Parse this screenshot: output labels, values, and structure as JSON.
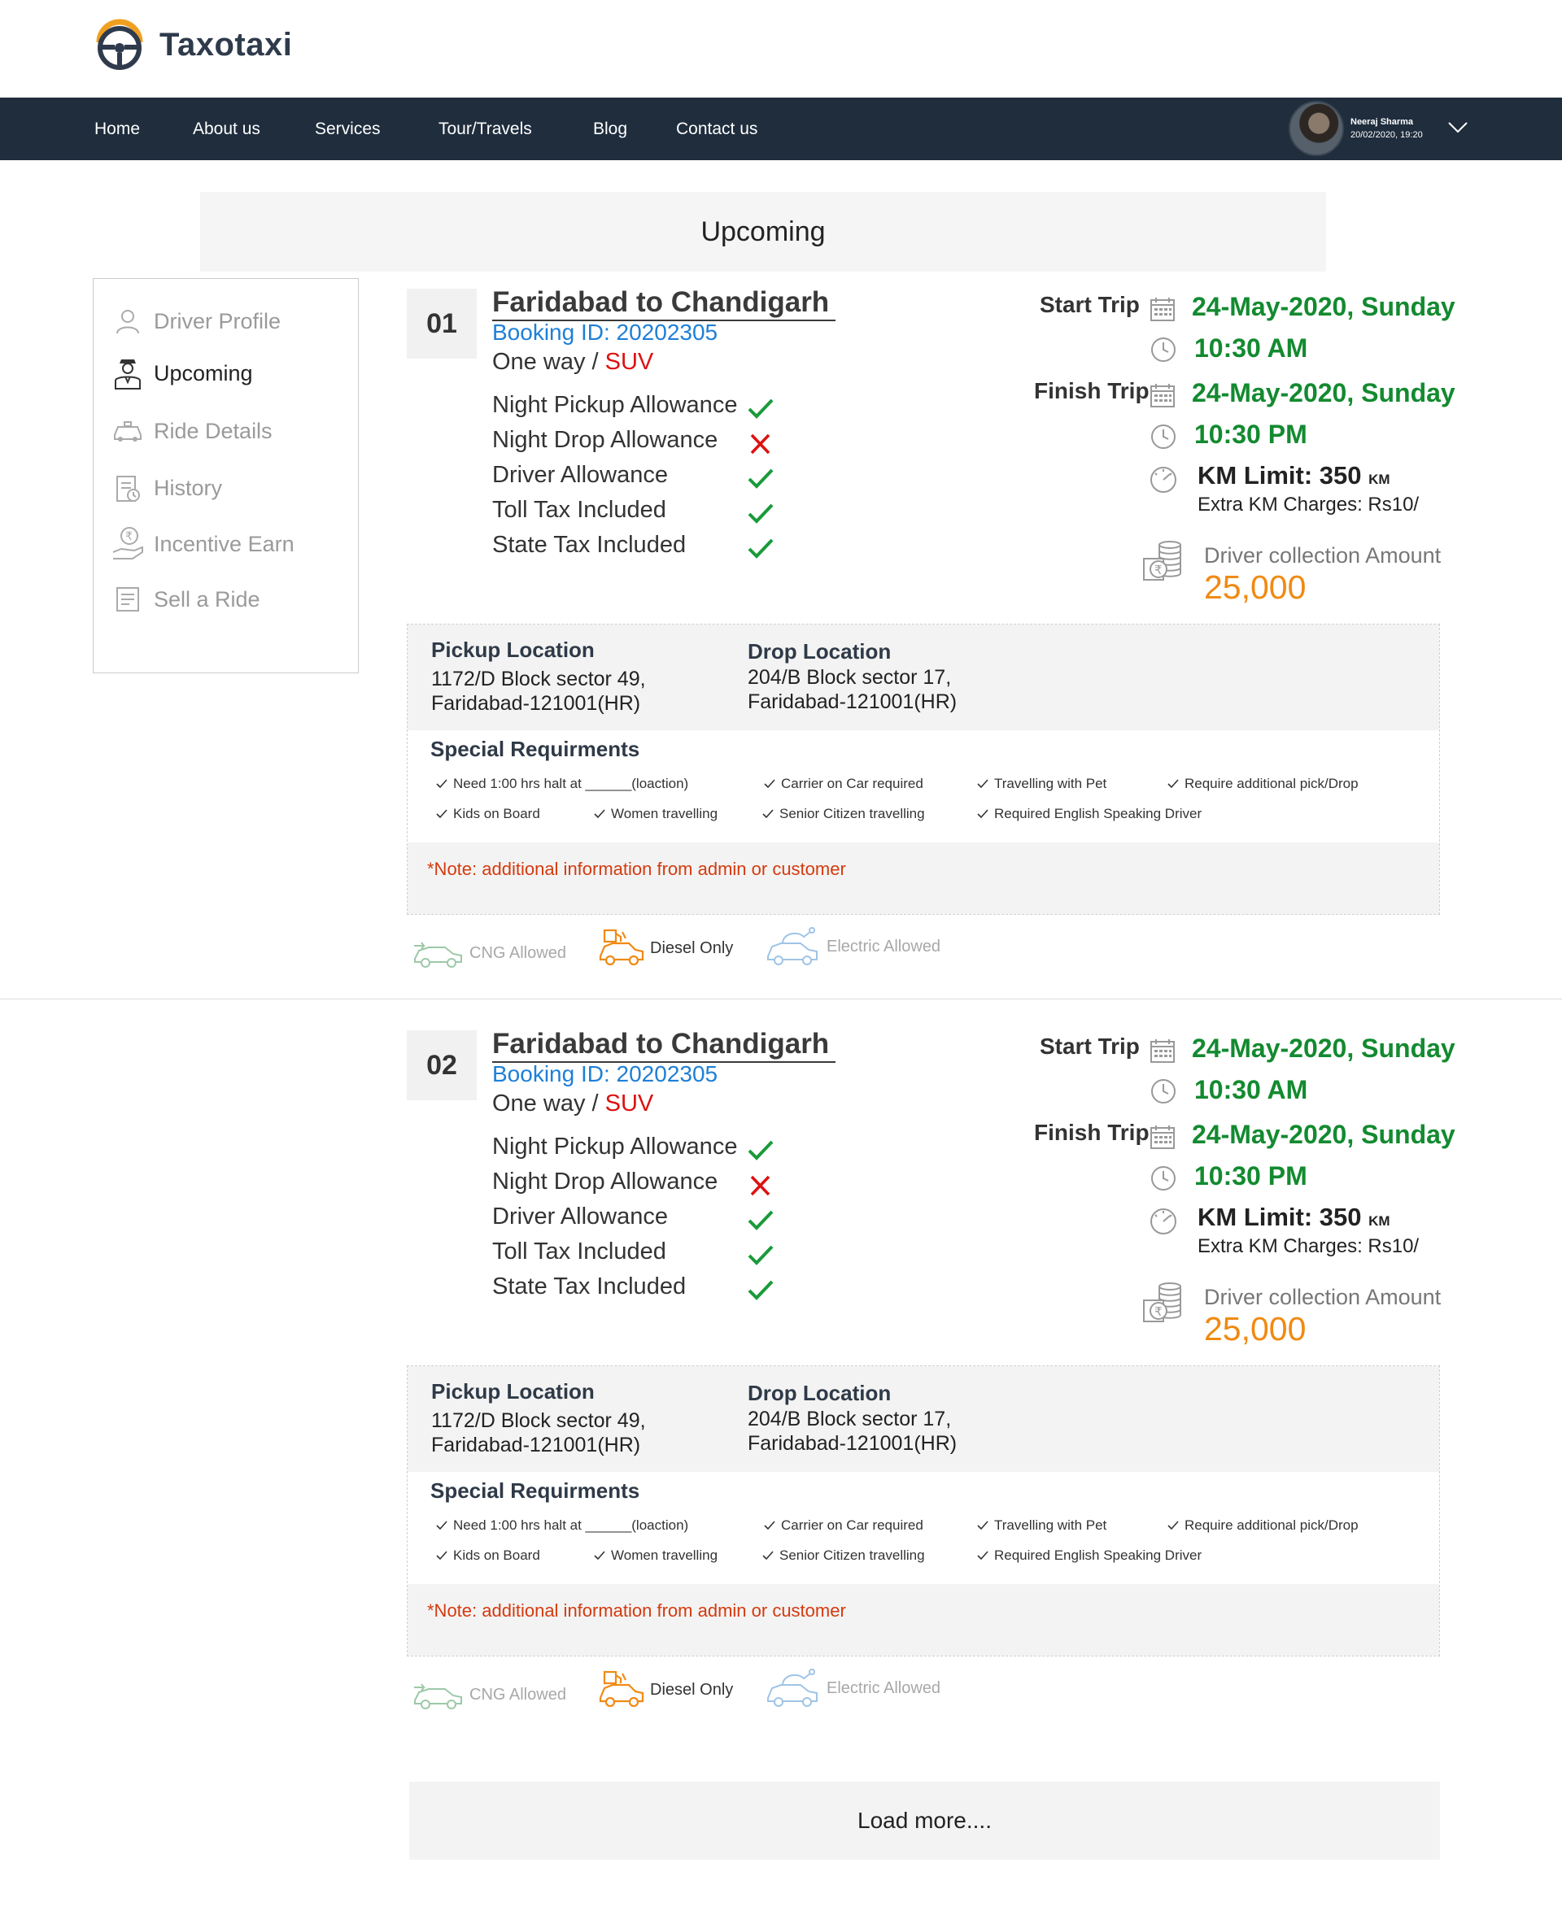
{
  "brand": {
    "name": "Taxotaxi"
  },
  "nav": {
    "items": [
      "Home",
      "About us",
      "Services",
      "Tour/Travels",
      "Blog",
      "Contact us"
    ]
  },
  "user": {
    "name": "Neeraj Sharma",
    "datetime": "20/02/2020,  19:20"
  },
  "page": {
    "title": "Upcoming"
  },
  "sidebar": {
    "items": [
      {
        "label": "Driver Profile",
        "icon": "user-icon",
        "active": false
      },
      {
        "label": "Upcoming",
        "icon": "driver-icon",
        "active": true
      },
      {
        "label": "Ride Details",
        "icon": "taxi-icon",
        "active": false
      },
      {
        "label": "History",
        "icon": "history-icon",
        "active": false
      },
      {
        "label": "Incentive Earn",
        "icon": "rupee-hand-icon",
        "active": false
      },
      {
        "label": "Sell a Ride",
        "icon": "list-icon",
        "active": false
      }
    ]
  },
  "rides": [
    {
      "number": "01",
      "route": "Faridabad to  Chandigarh",
      "booking_id": "Booking ID: 20202305",
      "trip_type": "One way",
      "separator": " / ",
      "vehicle": "SUV",
      "allowances": [
        {
          "label": "Night Pickup Allowance",
          "included": true
        },
        {
          "label": "Night Drop Allowance",
          "included": false
        },
        {
          "label": "Driver Allowance",
          "included": true
        },
        {
          "label": "Toll Tax Included",
          "included": true
        },
        {
          "label": "State Tax Included",
          "included": true
        }
      ],
      "start_label": "Start Trip",
      "start_date": "24-May-2020, Sunday",
      "start_time": "10:30 AM",
      "finish_label": "Finish Trip",
      "finish_date": "24-May-2020, Sunday",
      "finish_time": "10:30 PM",
      "km_label": "KM Limit: 350",
      "km_unit": "KM",
      "extra_km": "Extra KM Charges: Rs10/",
      "collection_label": "Driver collection Amount",
      "collection_amount": "25,000",
      "pickup_title": "Pickup Location",
      "pickup_line1": "1172/D Block sector 49,",
      "pickup_line2": "Faridabad-121001(HR)",
      "drop_title": "Drop Location",
      "drop_line1": "204/B Block sector 17,",
      "drop_line2": "Faridabad-121001(HR)",
      "special_title": "Special Requirments",
      "requirements": [
        "Need 1:00 hrs halt at ______(loaction)",
        "Carrier on Car required",
        "Travelling with Pet",
        "Require additional pick/Drop",
        "Kids on Board",
        "Women travelling",
        "Senior Citizen travelling",
        "Required English Speaking Driver"
      ],
      "note": "*Note: additional information from admin or customer",
      "fuel": [
        {
          "label": "CNG Allowed",
          "icon": "cng-car-icon",
          "color": "#9cc9a8",
          "active": false
        },
        {
          "label": "Diesel Only",
          "icon": "diesel-car-icon",
          "color": "#f08a12",
          "active": true
        },
        {
          "label": "Electric Allowed",
          "icon": "electric-car-icon",
          "color": "#9fc4e6",
          "active": false
        }
      ]
    },
    {
      "number": "02",
      "route": "Faridabad to  Chandigarh",
      "booking_id": "Booking ID: 20202305",
      "trip_type": "One way",
      "separator": " / ",
      "vehicle": "SUV",
      "allowances": [
        {
          "label": "Night Pickup Allowance",
          "included": true
        },
        {
          "label": "Night Drop Allowance",
          "included": false
        },
        {
          "label": "Driver Allowance",
          "included": true
        },
        {
          "label": "Toll Tax Included",
          "included": true
        },
        {
          "label": "State Tax Included",
          "included": true
        }
      ],
      "start_label": "Start Trip",
      "start_date": "24-May-2020, Sunday",
      "start_time": "10:30 AM",
      "finish_label": "Finish Trip",
      "finish_date": "24-May-2020, Sunday",
      "finish_time": "10:30 PM",
      "km_label": "KM Limit: 350",
      "km_unit": "KM",
      "extra_km": "Extra KM Charges: Rs10/",
      "collection_label": "Driver collection Amount",
      "collection_amount": "25,000",
      "pickup_title": "Pickup Location",
      "pickup_line1": "1172/D Block sector 49,",
      "pickup_line2": "Faridabad-121001(HR)",
      "drop_title": "Drop Location",
      "drop_line1": "204/B Block sector 17,",
      "drop_line2": "Faridabad-121001(HR)",
      "special_title": "Special Requirments",
      "requirements": [
        "Need 1:00 hrs halt at ______(loaction)",
        "Carrier on Car required",
        "Travelling with Pet",
        "Require additional pick/Drop",
        "Kids on Board",
        "Women travelling",
        "Senior Citizen travelling",
        "Required English Speaking Driver"
      ],
      "note": "*Note: additional information from admin or customer",
      "fuel": [
        {
          "label": "CNG Allowed",
          "icon": "cng-car-icon",
          "color": "#9cc9a8",
          "active": false
        },
        {
          "label": "Diesel Only",
          "icon": "diesel-car-icon",
          "color": "#f08a12",
          "active": true
        },
        {
          "label": "Electric Allowed",
          "icon": "electric-car-icon",
          "color": "#9fc4e6",
          "active": false
        }
      ]
    }
  ],
  "load_more": "Load more...."
}
